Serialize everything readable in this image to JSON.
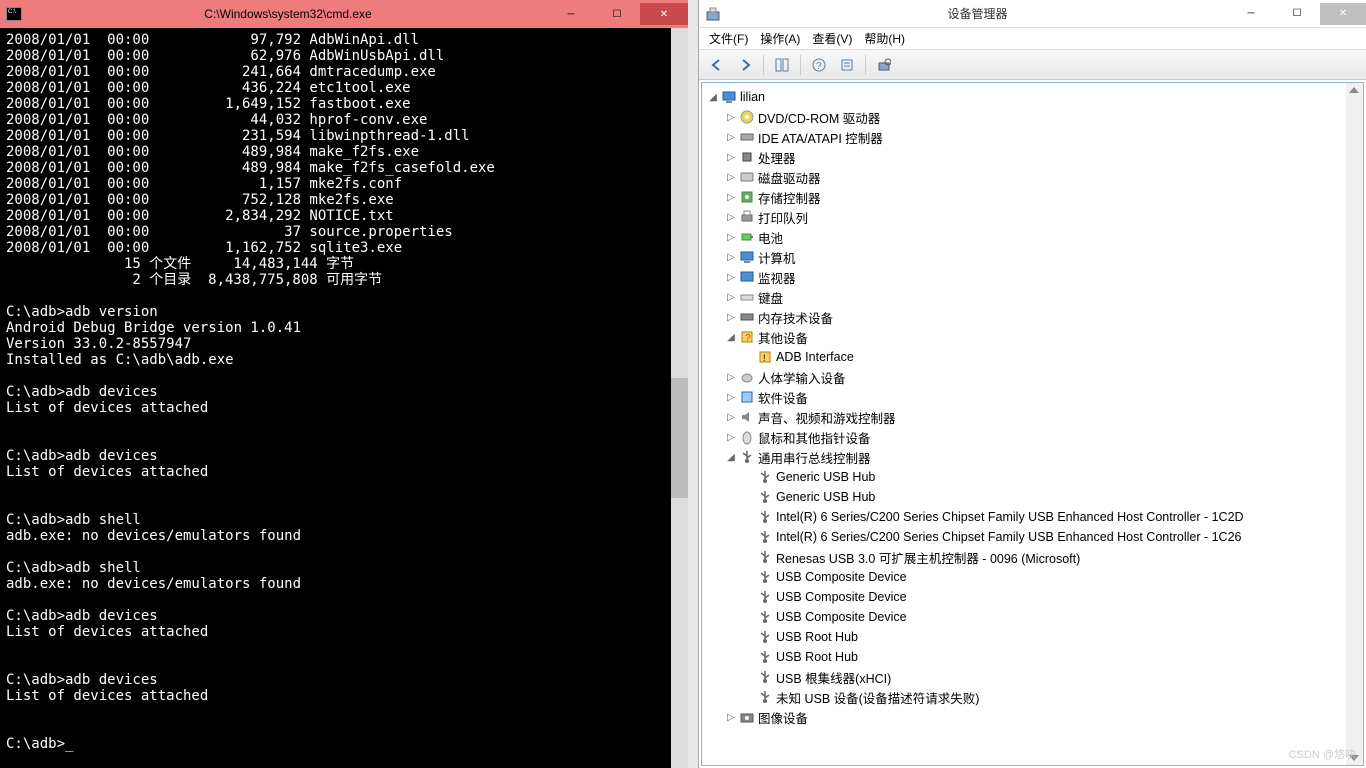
{
  "cmd": {
    "title": "C:\\Windows\\system32\\cmd.exe",
    "files": [
      {
        "date": "2008/01/01",
        "time": "00:00",
        "size": "97,792",
        "name": "AdbWinApi.dll"
      },
      {
        "date": "2008/01/01",
        "time": "00:00",
        "size": "62,976",
        "name": "AdbWinUsbApi.dll"
      },
      {
        "date": "2008/01/01",
        "time": "00:00",
        "size": "241,664",
        "name": "dmtracedump.exe"
      },
      {
        "date": "2008/01/01",
        "time": "00:00",
        "size": "436,224",
        "name": "etc1tool.exe"
      },
      {
        "date": "2008/01/01",
        "time": "00:00",
        "size": "1,649,152",
        "name": "fastboot.exe"
      },
      {
        "date": "2008/01/01",
        "time": "00:00",
        "size": "44,032",
        "name": "hprof-conv.exe"
      },
      {
        "date": "2008/01/01",
        "time": "00:00",
        "size": "231,594",
        "name": "libwinpthread-1.dll"
      },
      {
        "date": "2008/01/01",
        "time": "00:00",
        "size": "489,984",
        "name": "make_f2fs.exe"
      },
      {
        "date": "2008/01/01",
        "time": "00:00",
        "size": "489,984",
        "name": "make_f2fs_casefold.exe"
      },
      {
        "date": "2008/01/01",
        "time": "00:00",
        "size": "1,157",
        "name": "mke2fs.conf"
      },
      {
        "date": "2008/01/01",
        "time": "00:00",
        "size": "752,128",
        "name": "mke2fs.exe"
      },
      {
        "date": "2008/01/01",
        "time": "00:00",
        "size": "2,834,292",
        "name": "NOTICE.txt"
      },
      {
        "date": "2008/01/01",
        "time": "00:00",
        "size": "37",
        "name": "source.properties"
      },
      {
        "date": "2008/01/01",
        "time": "00:00",
        "size": "1,162,752",
        "name": "sqlite3.exe"
      }
    ],
    "summary1_count": "15",
    "summary1_label": "个文件",
    "summary1_bytes": "14,483,144",
    "summary1_unit": "字节",
    "summary2_count": "2",
    "summary2_label": "个目录",
    "summary2_bytes": "8,438,775,808",
    "summary2_unit": "可用字节",
    "prompt": "C:\\adb>",
    "cmd_version": "adb version",
    "version_line1": "Android Debug Bridge version 1.0.41",
    "version_line2": "Version 33.0.2-8557947",
    "version_line3": "Installed as C:\\adb\\adb.exe",
    "cmd_devices": "adb devices",
    "devices_resp": "List of devices attached",
    "cmd_shell": "adb shell",
    "shell_err": "adb.exe: no devices/emulators found"
  },
  "dm": {
    "title": "设备管理器",
    "menu": {
      "file": "文件(F)",
      "action": "操作(A)",
      "view": "查看(V)",
      "help": "帮助(H)"
    },
    "root": "lilian",
    "categories": [
      {
        "label": "DVD/CD-ROM 驱动器",
        "icon": "disc"
      },
      {
        "label": "IDE ATA/ATAPI 控制器",
        "icon": "ide"
      },
      {
        "label": "处理器",
        "icon": "cpu"
      },
      {
        "label": "磁盘驱动器",
        "icon": "disk"
      },
      {
        "label": "存储控制器",
        "icon": "storage"
      },
      {
        "label": "打印队列",
        "icon": "printer"
      },
      {
        "label": "电池",
        "icon": "battery"
      },
      {
        "label": "计算机",
        "icon": "computer"
      },
      {
        "label": "监视器",
        "icon": "monitor"
      },
      {
        "label": "键盘",
        "icon": "keyboard"
      },
      {
        "label": "内存技术设备",
        "icon": "memory"
      }
    ],
    "other_devices_label": "其他设备",
    "other_devices_child": "ADB Interface",
    "more_categories": [
      {
        "label": "人体学输入设备",
        "icon": "hid"
      },
      {
        "label": "软件设备",
        "icon": "software"
      },
      {
        "label": "声音、视频和游戏控制器",
        "icon": "audio"
      },
      {
        "label": "鼠标和其他指针设备",
        "icon": "mouse"
      }
    ],
    "usb_label": "通用串行总线控制器",
    "usb_children": [
      "Generic USB Hub",
      "Generic USB Hub",
      "Intel(R) 6 Series/C200 Series Chipset Family USB Enhanced Host Controller - 1C2D",
      "Intel(R) 6 Series/C200 Series Chipset Family USB Enhanced Host Controller - 1C26",
      "Renesas USB 3.0 可扩展主机控制器 - 0096 (Microsoft)",
      "USB Composite Device",
      "USB Composite Device",
      "USB Composite Device",
      "USB Root Hub",
      "USB Root Hub",
      "USB 根集线器(xHCI)",
      "未知 USB 设备(设备描述符请求失败)"
    ],
    "imaging_label": "图像设备"
  },
  "watermark": "CSDN @悠吷"
}
